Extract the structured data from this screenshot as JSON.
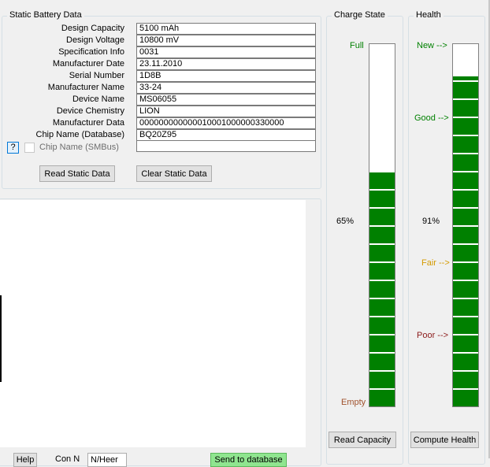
{
  "static_data": {
    "title": "Static Battery Data",
    "rows": [
      {
        "label": "Design Capacity",
        "value": "5100 mAh"
      },
      {
        "label": "Design Voltage",
        "value": "10800 mV"
      },
      {
        "label": "Specification Info",
        "value": "0031"
      },
      {
        "label": "Manufacturer Date",
        "value": "23.11.2010"
      },
      {
        "label": "Serial Number",
        "value": "1D8B"
      },
      {
        "label": "Manufacturer Name",
        "value": "33-24"
      },
      {
        "label": "Device Name",
        "value": "MS06055"
      },
      {
        "label": "Device Chemistry",
        "value": "LION"
      },
      {
        "label": "Manufacturer Data",
        "value": "000000000000010001000000330000"
      },
      {
        "label": "Chip Name (Database)",
        "value": "BQ20Z95"
      }
    ],
    "chip_smbus_label": "Chip Name (SMBus)",
    "chip_smbus_value": "",
    "help_label": "?",
    "read_button": "Read Static Data",
    "clear_button": "Clear Static Data"
  },
  "charge_state": {
    "title": "Charge State",
    "full_label": "Full",
    "empty_label": "Empty",
    "percent_label": "65%",
    "level_percent": 65,
    "read_button": "Read Capacity"
  },
  "health": {
    "title": "Health",
    "new_label": "New -->",
    "good_label": "Good -->",
    "fair_label": "Fair -->",
    "poor_label": "Poor -->",
    "percent_label": "91%",
    "level_percent": 91,
    "compute_button": "Compute Health"
  },
  "bottom_bar": {
    "button1_label": "Help",
    "label_mid": "Con N",
    "dropdown_value": "N/Heer",
    "green_button_label": "Send to database"
  },
  "colors": {
    "gauge_fill": "#008000",
    "full_label": "#008000",
    "empty_label": "#a0522d",
    "new_label": "#008000",
    "good_label": "#008000",
    "fair_label": "#d49a00",
    "poor_label": "#8b1a1a",
    "green_button": "#8fe58f"
  }
}
